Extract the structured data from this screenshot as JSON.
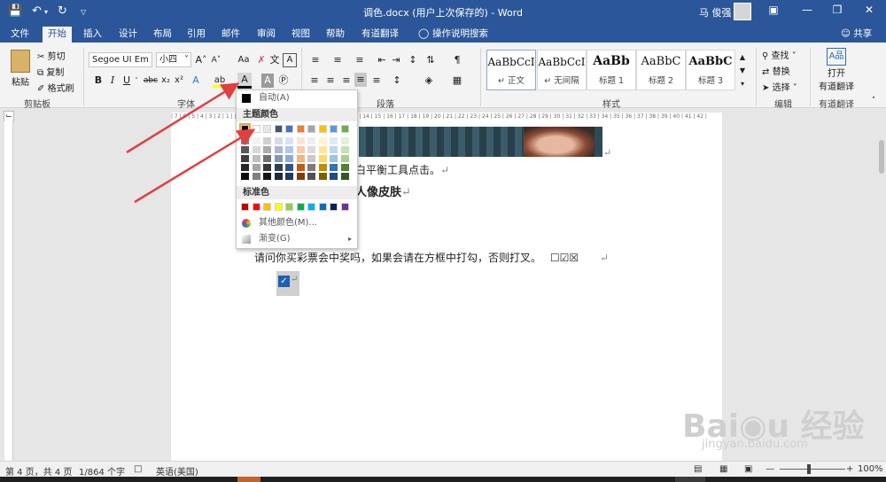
{
  "titlebar": {
    "title": "调色.docx (用户上次保存的) - Word",
    "user": "马 俊强"
  },
  "tabs": [
    {
      "label": "文件"
    },
    {
      "label": "开始"
    },
    {
      "label": "插入"
    },
    {
      "label": "设计"
    },
    {
      "label": "布局"
    },
    {
      "label": "引用"
    },
    {
      "label": "邮件"
    },
    {
      "label": "审阅"
    },
    {
      "label": "视图"
    },
    {
      "label": "帮助"
    },
    {
      "label": "有道翻译"
    }
  ],
  "tell_me": "操作说明搜索",
  "share": "共享",
  "clipboard": {
    "paste": "粘贴",
    "cut": "剪切",
    "copy": "复制",
    "format_painter": "格式刷",
    "label": "剪贴板"
  },
  "font": {
    "name": "Segoe UI Em",
    "size": "小四",
    "label": "字体",
    "grow": "A˄",
    "shrink": "A˅",
    "clear": "Aa",
    "phonetic": "文",
    "border": "A"
  },
  "paragraph": {
    "label": "段落"
  },
  "styles": {
    "label": "样式",
    "items": [
      {
        "preview": "AaBbCcI",
        "name": "正文"
      },
      {
        "preview": "AaBbCcI",
        "name": "无间隔"
      },
      {
        "preview": "AaBb",
        "name": "标题 1"
      },
      {
        "preview": "AaBbC",
        "name": "标题 2"
      },
      {
        "preview": "AaBbC",
        "name": "标题 3"
      }
    ]
  },
  "editing": {
    "find": "查找",
    "replace": "替换",
    "select": "选择",
    "label": "编辑"
  },
  "translate": {
    "open": "打开",
    "name": "有道翻译",
    "label": "有道翻译"
  },
  "ruler_text": "| 7 | 6 | 5 | 4 | 3 | 2 | 1 |   | 1 | 2 | 3 | 4 | 5 | 6 | 7 | 8 | 9 | 10 | 11 | 12 | 13 | 14 | 15 | 16 | 17 | 18 | 19 | 20 | 21 | 22 | 23 | 24 | 25 | 26 | 27 | 28 | 29 | 30 | 31 | 32 | 33 | 34 | 35 | 36 | 37 | 38 | 39 | 40 | 41 | 42 |",
  "document": {
    "line1": "白平衡工具点击。",
    "heading": "人像皮肤",
    "sentence": "请问你买彩票会中奖吗，如果会请在方框中打勾，否则打叉。",
    "boxes": "☐☑☒",
    "return_mark": "↵"
  },
  "color_menu": {
    "auto": "自动(A)",
    "theme_header": "主题颜色",
    "standard_header": "标准色",
    "more_colors": "其他颜色(M)...",
    "gradient": "渐变(G)",
    "theme_top": [
      "#000000",
      "#ffffff",
      "#e7e6e6",
      "#44546a",
      "#4472c4",
      "#ed7d31",
      "#a5a5a5",
      "#ffc000",
      "#5b9bd5",
      "#70ad47"
    ],
    "theme_shades": [
      [
        "#7f7f7f",
        "#f2f2f2",
        "#d0cece",
        "#d6dce4",
        "#d9e2f3",
        "#fbe5d5",
        "#ededed",
        "#fff2cc",
        "#deeaf6",
        "#e2efd9"
      ],
      [
        "#595959",
        "#d8d8d8",
        "#aeaaaa",
        "#adb9ca",
        "#b4c6e7",
        "#f7cbac",
        "#dbdbdb",
        "#fee599",
        "#bdd7ee",
        "#c5e0b3"
      ],
      [
        "#3f3f3f",
        "#bfbfbf",
        "#757070",
        "#8496b0",
        "#8eaadb",
        "#f4b183",
        "#c9c9c9",
        "#ffd965",
        "#9cc3e5",
        "#a8d08d"
      ],
      [
        "#262626",
        "#a5a5a5",
        "#3a3838",
        "#323f4f",
        "#2f5496",
        "#c55a11",
        "#7b7b7b",
        "#bf8f00",
        "#2e75b5",
        "#538135"
      ],
      [
        "#0c0c0c",
        "#7f7f7f",
        "#171616",
        "#222a35",
        "#1f3864",
        "#833c0b",
        "#525252",
        "#7f6000",
        "#1e4e79",
        "#375623"
      ]
    ],
    "standard": [
      "#c00000",
      "#ff0000",
      "#ffc000",
      "#ffff00",
      "#92d050",
      "#00b050",
      "#00b0f0",
      "#0070c0",
      "#002060",
      "#7030a0"
    ]
  },
  "status": {
    "page": "第 4 页，共 4 页",
    "words": "1/864 个字",
    "language": "英语(美国)",
    "zoom": "100%"
  },
  "accent_color": "#2b579a",
  "arrow_color": "#e04040"
}
